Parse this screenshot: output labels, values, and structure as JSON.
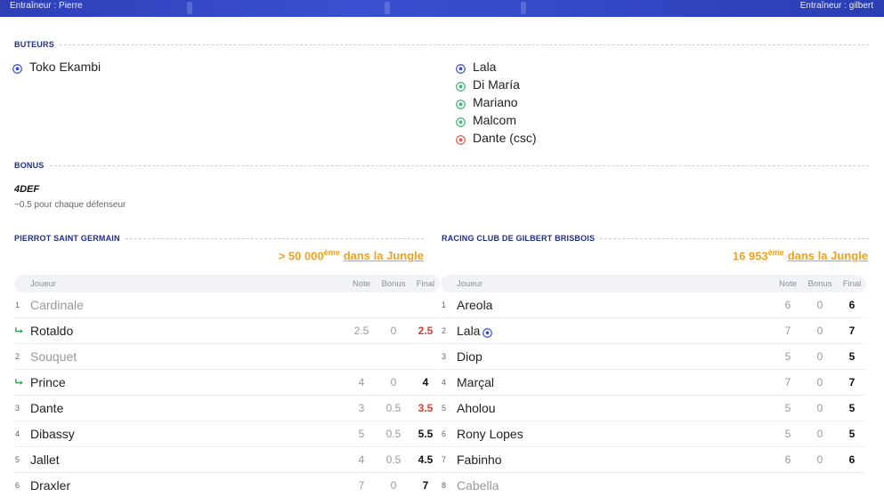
{
  "banner": {
    "coach_left": "Entraîneur : Pierre",
    "coach_right": "Entraîneur : gilbert"
  },
  "sections": {
    "scorers_title": "BUTEURS",
    "bonus_title": "BONUS",
    "home_team": "PIERROT SAINT GERMAIN",
    "away_team": "RACING CLUB DE GILBERT BRISBOIS"
  },
  "colors": {
    "accent_blue": "#1e2f8a",
    "banner_blue": "#3247c4",
    "goal_blue": "#3b4fc4",
    "goal_green": "#3cb371",
    "goal_red": "#e05a4f",
    "ranking_orange": "#f0a21e",
    "final_red": "#d6402b",
    "sub_green": "#2e9e4f"
  },
  "scorers": {
    "home": [
      {
        "name": "Toko Ekambi",
        "icon": "ball-blue-icon"
      }
    ],
    "away": [
      {
        "name": "Lala",
        "icon": "ball-blue-icon"
      },
      {
        "name": "Di María",
        "icon": "ball-green-icon"
      },
      {
        "name": "Mariano",
        "icon": "ball-green-icon"
      },
      {
        "name": "Malcom",
        "icon": "ball-green-icon"
      },
      {
        "name": "Dante (csc)",
        "icon": "ball-red-icon"
      }
    ]
  },
  "bonus": {
    "name": "4DEF",
    "description": "−0.5 pour chaque défenseur"
  },
  "ranking": {
    "home": {
      "position": "> 50 000",
      "suffix": "ème",
      "link": "dans la Jungle"
    },
    "away": {
      "position": "16 953",
      "suffix": "ème",
      "link": "dans la Jungle"
    }
  },
  "table_headers": {
    "player": "Joueur",
    "note": "Note",
    "bonus": "Bonus",
    "final": "Final"
  },
  "home_players": [
    {
      "num": "1",
      "name": "Cardinale",
      "bench": true,
      "note": "",
      "bonus": "",
      "final": ""
    },
    {
      "num": "",
      "sub": true,
      "name": "Rotaldo",
      "note": "2.5",
      "bonus": "0",
      "final": "2.5",
      "final_red": true
    },
    {
      "num": "2",
      "name": "Souquet",
      "bench": true,
      "note": "",
      "bonus": "",
      "final": ""
    },
    {
      "num": "",
      "sub": true,
      "name": "Prince",
      "note": "4",
      "bonus": "0",
      "final": "4"
    },
    {
      "num": "3",
      "name": "Dante",
      "note": "3",
      "bonus": "0.5",
      "final": "3.5",
      "final_red": true
    },
    {
      "num": "4",
      "name": "Dibassy",
      "note": "5",
      "bonus": "0.5",
      "final": "5.5"
    },
    {
      "num": "5",
      "name": "Jallet",
      "note": "4",
      "bonus": "0.5",
      "final": "4.5"
    },
    {
      "num": "6",
      "name": "Draxler",
      "note": "7",
      "bonus": "0",
      "final": "7"
    }
  ],
  "away_players": [
    {
      "num": "1",
      "name": "Areola",
      "note": "6",
      "bonus": "0",
      "final": "6"
    },
    {
      "num": "2",
      "name": "Lala",
      "goal": true,
      "note": "7",
      "bonus": "0",
      "final": "7"
    },
    {
      "num": "3",
      "name": "Diop",
      "note": "5",
      "bonus": "0",
      "final": "5"
    },
    {
      "num": "4",
      "name": "Marçal",
      "note": "7",
      "bonus": "0",
      "final": "7"
    },
    {
      "num": "5",
      "name": "Aholou",
      "note": "5",
      "bonus": "0",
      "final": "5"
    },
    {
      "num": "6",
      "name": "Rony Lopes",
      "note": "5",
      "bonus": "0",
      "final": "5"
    },
    {
      "num": "7",
      "name": "Fabinho",
      "note": "6",
      "bonus": "0",
      "final": "6"
    },
    {
      "num": "8",
      "name": "Cabella",
      "bench": true,
      "note": "",
      "bonus": "",
      "final": ""
    }
  ]
}
